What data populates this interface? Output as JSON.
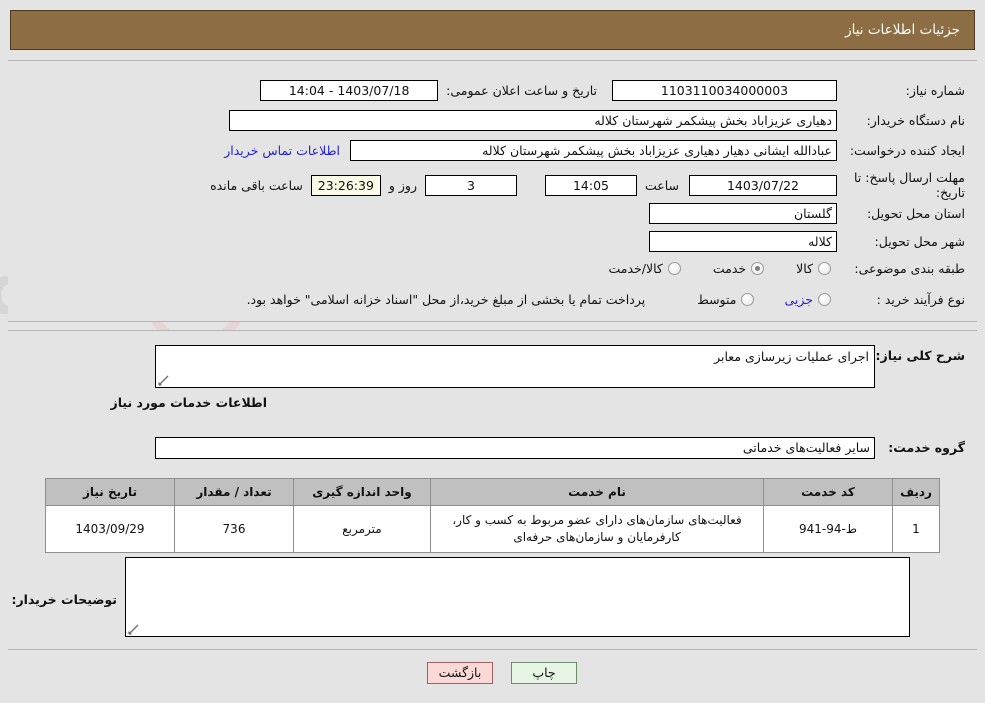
{
  "header": {
    "title": "جزئیات اطلاعات نیاز"
  },
  "top": {
    "need_number_label": "شماره نیاز:",
    "need_number_value": "1103110034000003",
    "announce_datetime_label": "تاریخ و ساعت اعلان عمومی:",
    "announce_datetime_value": "1403/07/18 - 14:04",
    "buyer_org_label": "نام دستگاه خریدار:",
    "buyer_org_value": "دهیاری عزیزاباد بخش پیشکمر شهرستان کلاله",
    "creator_label": "ایجاد کننده درخواست:",
    "creator_value": "عبادالله ایشانی دهیار دهیاری عزیزاباد بخش پیشکمر شهرستان کلاله",
    "contact_link": "اطلاعات تماس خریدار",
    "deadline_label": "مهلت ارسال پاسخ: تا تاریخ:",
    "deadline_date": "1403/07/22",
    "hour_label": "ساعت",
    "hour_value": "14:05",
    "days_value": "3",
    "days_label": "روز و",
    "remaining_value": "23:26:39",
    "remaining_label": "ساعت باقی مانده",
    "province_label": "استان محل تحویل:",
    "province_value": "گلستان",
    "city_label": "شهر محل تحویل:",
    "city_value": "کلاله",
    "category_label": "طبقه بندی موضوعی:",
    "category_options": [
      {
        "label": "کالا",
        "checked": false
      },
      {
        "label": "خدمت",
        "checked": true
      },
      {
        "label": "کالا/خدمت",
        "checked": false
      }
    ],
    "process_label": "نوع فرآیند خرید :",
    "process_options": [
      {
        "label": "جزیی",
        "checked": false
      },
      {
        "label": "متوسط",
        "checked": false
      }
    ],
    "treasury_note": "پرداخت تمام یا بخشی از مبلغ خرید،از محل \"اسناد خزانه اسلامی\" خواهد بود."
  },
  "mid": {
    "general_desc_label": "شرح کلی نیاز:",
    "general_desc_value": "اجرای عملیات زیرسازی معابر",
    "services_section_title": "اطلاعات خدمات مورد نیاز",
    "service_group_label": "گروه خدمت:",
    "service_group_value": "سایر فعالیت‌های خدماتی",
    "buyer_notes_label": "توضیحات خریدار:",
    "buyer_notes_value": ""
  },
  "table": {
    "columns": [
      "ردیف",
      "کد خدمت",
      "نام خدمت",
      "واحد اندازه گیری",
      "تعداد / مقدار",
      "تاریخ نیاز"
    ],
    "rows": [
      {
        "row": "1",
        "code": "ط-94-941",
        "name": "فعالیت‌های سازمان‌های دارای عضو مربوط به کسب و کار، کارفرمایان و سازمان‌های حرفه‌ای",
        "unit": "مترمربع",
        "qty": "736",
        "date": "1403/09/29"
      }
    ]
  },
  "footer": {
    "print_label": "چاپ",
    "back_label": "بازگشت"
  },
  "watermark": {
    "text": "AriaTender.net"
  },
  "colors": {
    "header_bg": "#8d6e44",
    "page_bg": "#e4e4e4",
    "table_header_bg": "#c0c0c0",
    "link": "#2222cc",
    "print_btn": "#e8f6e6",
    "back_btn": "#fbd9d7",
    "countdown_bg": "#fbfbe8"
  }
}
